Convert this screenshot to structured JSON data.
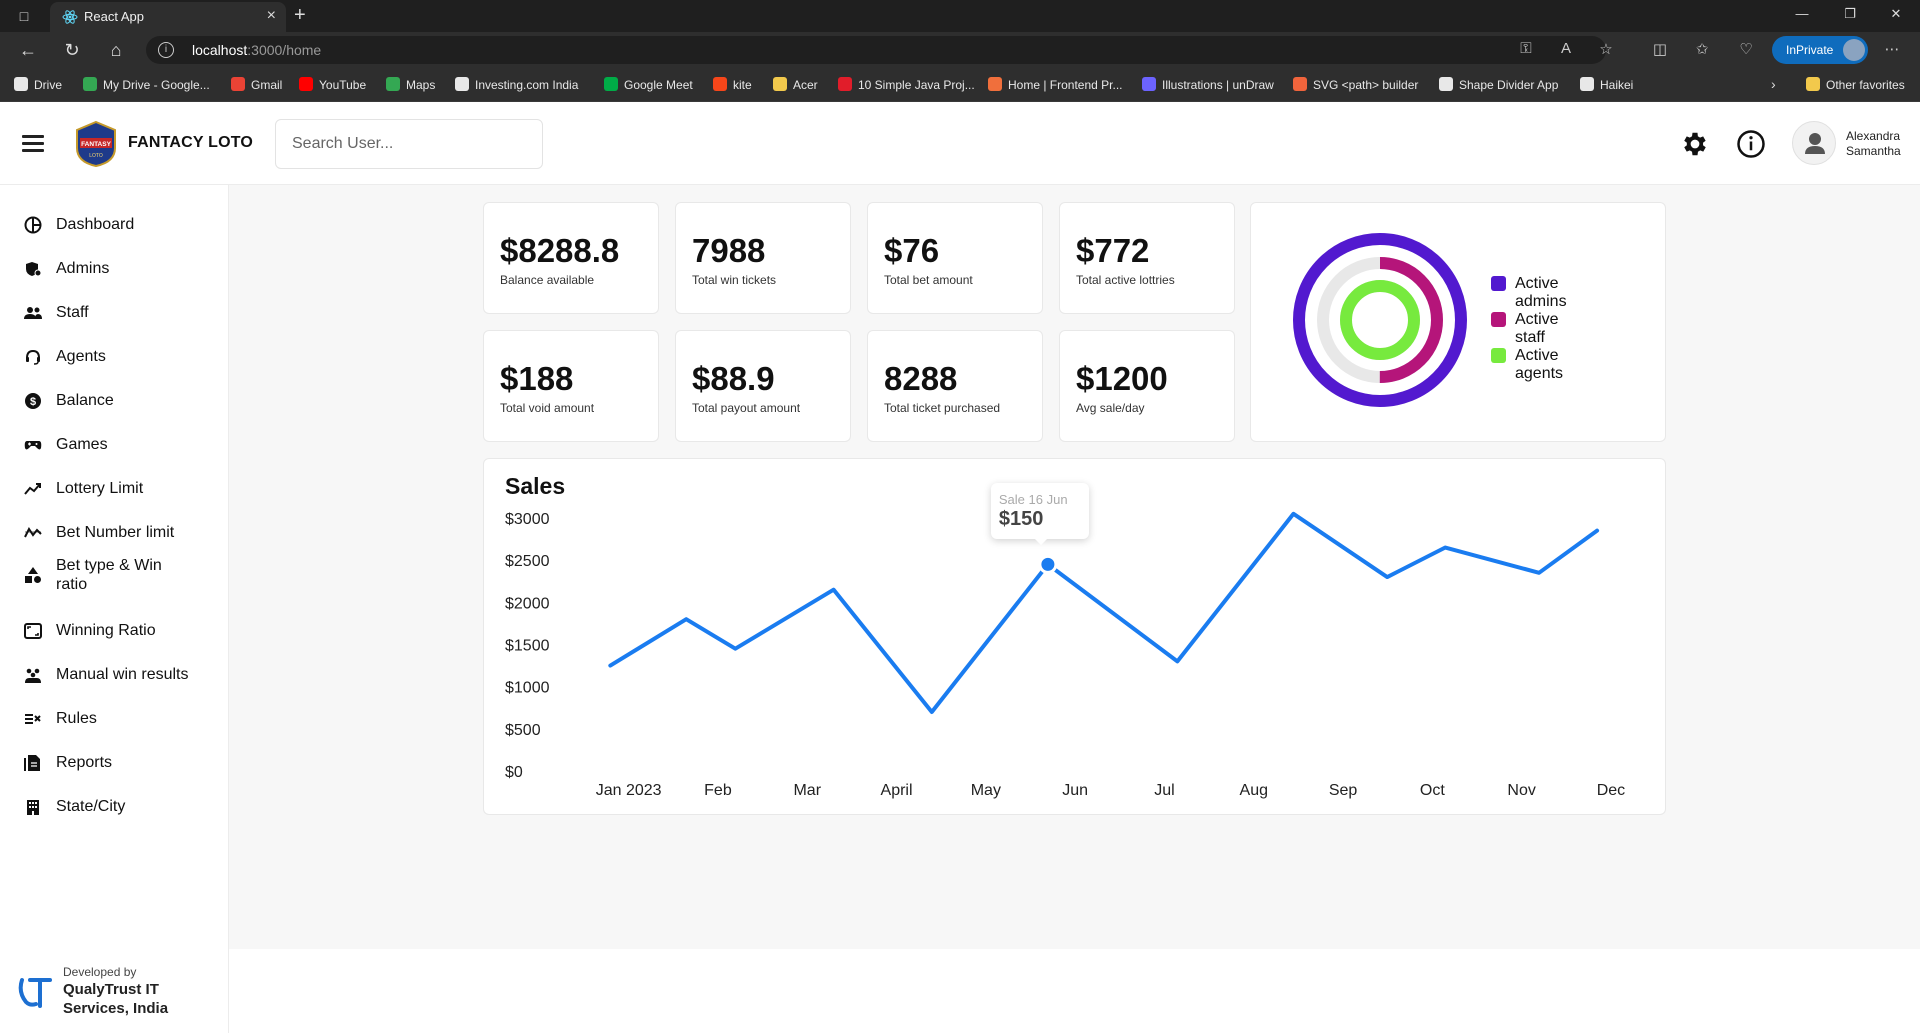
{
  "browser": {
    "tab_title": "React App",
    "url_host": "localhost",
    "url_path": ":3000/home",
    "inprivate_label": "InPrivate",
    "bookmarks": [
      {
        "label": "Drive",
        "icon": "file-icon",
        "color": "#e8e8e8"
      },
      {
        "label": "My Drive - Google...",
        "icon": "google-drive-icon",
        "color": "#34a853"
      },
      {
        "label": "Gmail",
        "icon": "gmail-icon",
        "color": "#ea4335"
      },
      {
        "label": "YouTube",
        "icon": "youtube-icon",
        "color": "#ff0000"
      },
      {
        "label": "Maps",
        "icon": "maps-icon",
        "color": "#34a853"
      },
      {
        "label": "Investing.com India",
        "icon": "investing-icon",
        "color": "#e8e8e8"
      },
      {
        "label": "Google Meet",
        "icon": "google-meet-icon",
        "color": "#00ac47"
      },
      {
        "label": "kite",
        "icon": "kite-icon",
        "color": "#f6461a"
      },
      {
        "label": "Acer",
        "icon": "folder-icon",
        "color": "#f2c94c"
      },
      {
        "label": "10 Simple Java Proj...",
        "icon": "java-icon",
        "color": "#e11d2a"
      },
      {
        "label": "Home | Frontend Pr...",
        "icon": "frontend-icon",
        "color": "#f06f3c"
      },
      {
        "label": "Illustrations | unDraw",
        "icon": "undraw-icon",
        "color": "#6c63ff"
      },
      {
        "label": "SVG <path> builder",
        "icon": "svg-builder-icon",
        "color": "#f0643c"
      },
      {
        "label": "Shape Divider App",
        "icon": "shape-divider-icon",
        "color": "#e8e8e8"
      },
      {
        "label": "Haikei",
        "icon": "file-icon",
        "color": "#e8e8e8"
      }
    ],
    "other_favorites": "Other favorites"
  },
  "header": {
    "brand": "FANTACY LOTO",
    "search_placeholder": "Search User...",
    "user_first": "Alexandra",
    "user_last": "Samantha"
  },
  "sidebar": {
    "items": [
      {
        "label": "Dashboard",
        "icon": "dashboard-icon"
      },
      {
        "label": "Admins",
        "icon": "admin-shield-icon"
      },
      {
        "label": "Staff",
        "icon": "staff-icon"
      },
      {
        "label": "Agents",
        "icon": "agent-headset-icon"
      },
      {
        "label": "Balance",
        "icon": "dollar-icon"
      },
      {
        "label": "Games",
        "icon": "gamepad-icon"
      },
      {
        "label": "Lottery Limit",
        "icon": "trending-icon"
      },
      {
        "label": "Bet Number limit",
        "icon": "stock-line-icon"
      },
      {
        "label": "Bet type & Win ratio",
        "icon": "shapes-icon"
      },
      {
        "label": "Winning Ratio",
        "icon": "ratio-icon"
      },
      {
        "label": "Manual win results",
        "icon": "group-icon"
      },
      {
        "label": "Rules",
        "icon": "rules-icon"
      },
      {
        "label": "Reports",
        "icon": "reports-icon"
      },
      {
        "label": "State/City",
        "icon": "building-icon"
      }
    ],
    "developed_by": "Developed by",
    "company_line1": "QualyTrust IT",
    "company_line2": "Services, India"
  },
  "stats": [
    {
      "value": "$8288.8",
      "label": "Balance available"
    },
    {
      "value": "7988",
      "label": "Total win tickets"
    },
    {
      "value": "$76",
      "label": "Total bet amount"
    },
    {
      "value": "$772",
      "label": "Total active lottries"
    },
    {
      "value": "$188",
      "label": "Total void amount"
    },
    {
      "value": "$88.9",
      "label": "Total payout amount"
    },
    {
      "value": "8288",
      "label": "Total ticket purchased"
    },
    {
      "value": "$1200",
      "label": "Avg sale/day"
    }
  ],
  "activity": {
    "legend": [
      {
        "label": "Active admins",
        "color": "#5219cf",
        "fraction": 1.0
      },
      {
        "label": "Active staff",
        "color": "#b5157a",
        "fraction": 0.5
      },
      {
        "label": "Active agents",
        "color": "#77ea3e",
        "fraction": 1.0
      }
    ],
    "track_color": "#e8e8e8"
  },
  "sales": {
    "title": "Sales",
    "tooltip_label": "Sale 16 Jun",
    "tooltip_value": "$150"
  },
  "chart_data": {
    "type": "line",
    "title": "Sales",
    "categories": [
      "Jan 2023",
      "Feb",
      "Mar",
      "April",
      "May",
      "Jun",
      "Jul",
      "Aug",
      "Sep",
      "Oct",
      "Nov",
      "Dec"
    ],
    "y_ticks": [
      "$3000",
      "$2500",
      "$2000",
      "$1500",
      "$1000",
      "$500",
      "$0"
    ],
    "ylim": [
      0,
      3000
    ],
    "points": [
      {
        "x": 0.25,
        "y": 1250
      },
      {
        "x": 1.1,
        "y": 1800
      },
      {
        "x": 1.65,
        "y": 1450
      },
      {
        "x": 2.75,
        "y": 2150
      },
      {
        "x": 3.85,
        "y": 700
      },
      {
        "x": 5.15,
        "y": 2450
      },
      {
        "x": 6.6,
        "y": 1300
      },
      {
        "x": 7.9,
        "y": 3050
      },
      {
        "x": 8.95,
        "y": 2300
      },
      {
        "x": 9.6,
        "y": 2650
      },
      {
        "x": 10.65,
        "y": 2350
      },
      {
        "x": 11.3,
        "y": 2850
      }
    ],
    "highlight_index": 5,
    "line_color": "#1a7cf0",
    "grid": false
  }
}
